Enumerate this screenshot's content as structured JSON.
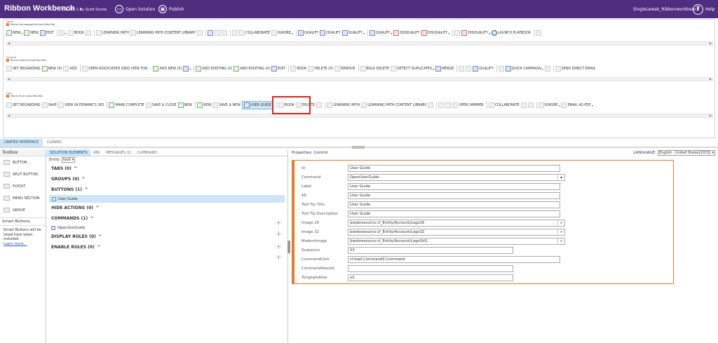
{
  "app": {
    "title": "Ribbon Workbench",
    "version": "2.1.442.1.9",
    "author": "by Scott Durow",
    "open_solution": "Open Solution",
    "publish": "Publish",
    "user": "SingleLewak_Ribbonworkbench",
    "help": "Help"
  },
  "ribbons": [
    {
      "label": "Home",
      "crumb": "Mscrm.HomepageGrid.lead.MainTab",
      "items": [
        {
          "t": "NEW",
          "i": "g",
          "a": 1
        },
        {
          "t": "NEW",
          "i": "g"
        },
        {
          "t": "EDIT",
          "i": "b"
        },
        {
          "t": "",
          "i": "ph",
          "a": 1
        },
        {
          "t": "BOOK",
          "i": "ph"
        },
        {
          "t": "",
          "i": "ph"
        },
        {
          "t": "LEARNING PATH",
          "i": "ph"
        },
        {
          "t": "LEARNING PATH CONTENT LIBRARY",
          "i": "ph"
        },
        {
          "t": "",
          "i": "ph"
        },
        {
          "t": "",
          "i": "b"
        },
        {
          "t": "",
          "i": "ph"
        },
        {
          "t": "",
          "i": "ph"
        },
        {
          "t": "",
          "i": "ph"
        },
        {
          "t": "COLLABORATE",
          "i": "ph"
        },
        {
          "t": "IGNORE",
          "i": "ph",
          "a": 1
        },
        {
          "t": "QUALIFY",
          "i": "b"
        },
        {
          "t": "QUALIFY",
          "i": "b"
        },
        {
          "t": "QUALIFY",
          "i": "b",
          "a": 1
        },
        {
          "t": "QUALIFY",
          "i": "b",
          "a": 1
        },
        {
          "t": "DISQUALIFY",
          "i": "r"
        },
        {
          "t": "DISQUALIFY",
          "i": "r",
          "a": 1
        },
        {
          "t": "",
          "i": "ph"
        },
        {
          "t": "DISQUALIFY",
          "i": "r",
          "a": 1
        },
        {
          "t": "LAUNCH PLAYBOOK",
          "i": "o"
        },
        {
          "t": "",
          "i": "ph"
        }
      ]
    },
    {
      "label": "SubGrid",
      "crumb": "Mscrm.SubGrid.lead.MainTab",
      "items": [
        {
          "t": "SET REGARDING",
          "i": "ph"
        },
        {
          "t": "NEW (0)",
          "i": "g"
        },
        {
          "t": "ADD",
          "i": "ph"
        },
        {
          "t": "OPEN ASSOCIATED GRID VIEW FOR ...",
          "i": "ph"
        },
        {
          "t": "ADD NEW (0)",
          "i": "g"
        },
        {
          "t": "",
          "i": "b",
          "a": 1
        },
        {
          "t": "ADD EXISTING (0)",
          "i": "g"
        },
        {
          "t": "ADD EXISTING (0)",
          "i": "g"
        },
        {
          "t": "EDIT",
          "i": "b"
        },
        {
          "t": "BOOK",
          "i": "ph"
        },
        {
          "t": "DELETE (0)",
          "i": "ph"
        },
        {
          "t": "REMOVE",
          "i": "ph"
        },
        {
          "t": "BULK DELETE",
          "i": "ph"
        },
        {
          "t": "DETECT DUPLICATES",
          "i": "ph",
          "a": 1
        },
        {
          "t": "MERGE",
          "i": "b"
        },
        {
          "t": "",
          "i": "ph"
        },
        {
          "t": "",
          "i": "ph"
        },
        {
          "t": "QUALIFY",
          "i": "b"
        },
        {
          "t": "",
          "i": "ph"
        },
        {
          "t": "QUICK CAMPAIGN",
          "i": "b",
          "a": 1
        },
        {
          "t": "",
          "i": "ph"
        },
        {
          "t": "SEND DIRECT EMAIL",
          "i": "ph"
        }
      ]
    },
    {
      "label": "Form",
      "crumb": "Mscrm.Form.lead.MainTab",
      "items": [
        {
          "t": "SET REGARDING",
          "i": "ph"
        },
        {
          "t": "SAVE",
          "i": "ph"
        },
        {
          "t": "VIEW IN DYNAMICS 365",
          "i": "ph"
        },
        {
          "t": "MARK COMPLETE",
          "i": "g"
        },
        {
          "t": "SAVE & CLOSE",
          "i": "ph"
        },
        {
          "t": "NEW",
          "i": "g"
        },
        {
          "t": "NEW",
          "i": "g"
        },
        {
          "t": "SAVE & NEW",
          "i": "ph"
        },
        {
          "t": "USER GUIDE",
          "i": "b",
          "hl": 1
        },
        {
          "t": "BOOK",
          "i": "ph"
        },
        {
          "t": "DELETE",
          "i": "ph"
        },
        {
          "t": "",
          "i": "ph"
        },
        {
          "t": "LEARNING PATH",
          "i": "ph"
        },
        {
          "t": "LEARNING PATH CONTENT LIBRARY",
          "i": "ph"
        },
        {
          "t": "",
          "i": "ph"
        },
        {
          "t": "",
          "i": "ph"
        },
        {
          "t": "",
          "i": "ph"
        },
        {
          "t": "OPEN YAMMER",
          "i": "ph"
        },
        {
          "t": "COLLABORATE",
          "i": "ph"
        },
        {
          "t": "",
          "i": "ph"
        },
        {
          "t": "",
          "i": "ph"
        },
        {
          "t": "IGNORE",
          "i": "ph",
          "a": 1
        },
        {
          "t": "EMAIL AS PDF",
          "i": "ph",
          "a": 1
        }
      ]
    }
  ],
  "mode_tabs": [
    "UNIFIED INTERFACE",
    "CLASSIC"
  ],
  "toolbox": {
    "title": "Toolbox",
    "items": [
      "BUTTON",
      "SPLIT BUTTON",
      "FLYOUT",
      "MENU SECTION",
      "GROUP"
    ],
    "smart_title": "Smart Buttons",
    "smart_text": "Smart Buttons will be listed here when installed.",
    "learn_more": "Learn more..."
  },
  "solution": {
    "tabs": [
      "SOLUTION ELEMENTS",
      "XML",
      "MESSAGES (1)",
      "CLIPBOARD"
    ],
    "entity_label": "Entity:",
    "entity_value": "lead",
    "tabs_section": "TABS (0)",
    "groups_section": "GROUPS (0)",
    "buttons_section": "BUTTONS (1)",
    "button_item": "User Guide",
    "hide_section": "HIDE ACTIONS (0)",
    "commands_section": "COMMANDS (1)",
    "command_item": "OpenUserGuide",
    "display_section": "DISPLAY RULES (0)",
    "enable_section": "ENABLE RULES (0)"
  },
  "properties": {
    "title": "Properties: Control",
    "language_label": "LANGUAGE:",
    "language_value": "English - United States[1033]",
    "fields": [
      {
        "label": "Id",
        "value": "User Guide"
      },
      {
        "label": "Command",
        "value": "OpenUserGuide",
        "type": "select"
      },
      {
        "label": "Label",
        "value": "User Guide"
      },
      {
        "label": "Alt",
        "value": "User Guide"
      },
      {
        "label": "Tool Tip Title",
        "value": "User Guide"
      },
      {
        "label": "Tool Tip Description",
        "value": "User Guide"
      },
      {
        "label": "Image 16",
        "value": "$webresource:cf_Entity/Account/Logo16",
        "type": "search"
      },
      {
        "label": "Image 32",
        "value": "$webresource:cf_Entity/Account/Logo32",
        "type": "search"
      },
      {
        "label": "ModernImage",
        "value": "$webresource:cf_Entity/Account/LogoSVG",
        "type": "search"
      },
      {
        "label": "Sequence",
        "value": "53"
      },
      {
        "label": "CommandCore",
        "value": "cf.lead.Command0.Command"
      },
      {
        "label": "CommandValueId",
        "value": ""
      },
      {
        "label": "TemplateAlias",
        "value": "o2"
      }
    ]
  }
}
